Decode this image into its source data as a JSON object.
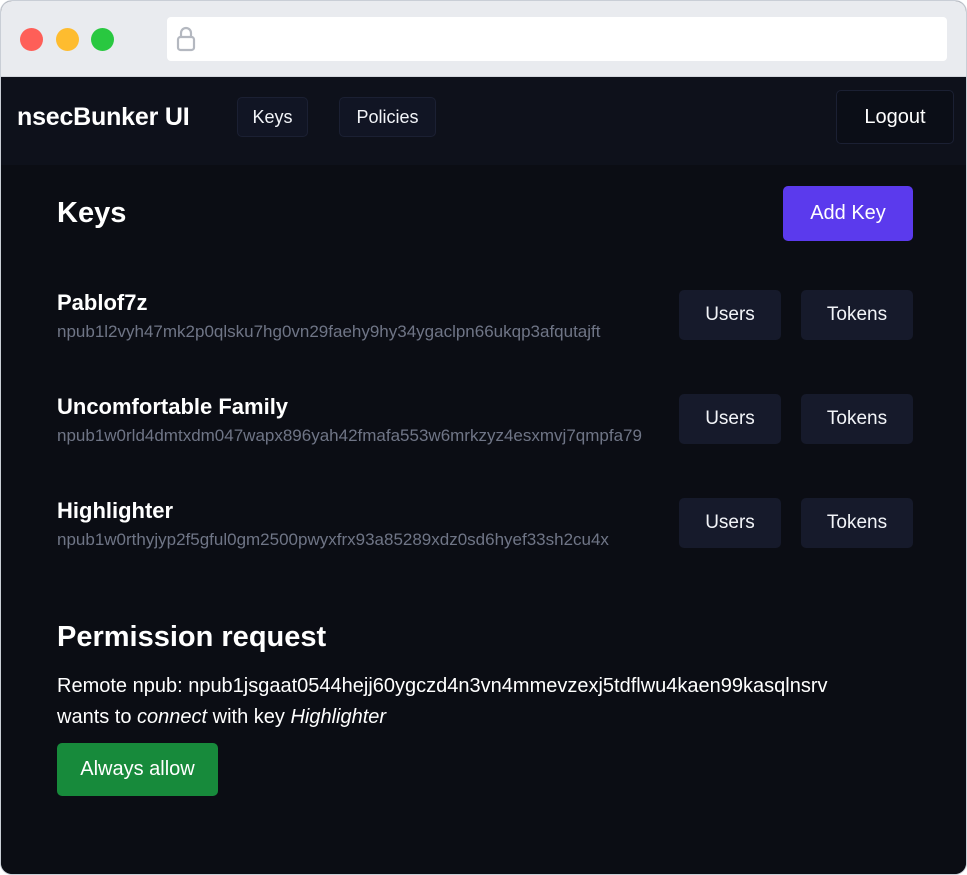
{
  "browser": {
    "url": "",
    "lock_icon": "lock-icon"
  },
  "navbar": {
    "brand": "nsecBunker UI",
    "keys_label": "Keys",
    "policies_label": "Policies",
    "logout_label": "Logout"
  },
  "main": {
    "title": "Keys",
    "add_key_label": "Add Key",
    "keys": [
      {
        "name": "Pablof7z",
        "npub": "npub1l2vyh47mk2p0qlsku7hg0vn29faehy9hy34ygaclpn66ukqp3afqutajft",
        "users_label": "Users",
        "tokens_label": "Tokens"
      },
      {
        "name": "Uncomfortable Family",
        "npub": "npub1w0rld4dmtxdm047wapx896yah42fmafa553w6mrkzyz4esxmvj7qmpfa79",
        "users_label": "Users",
        "tokens_label": "Tokens"
      },
      {
        "name": "Highlighter",
        "npub": "npub1w0rthyjyp2f5gful0gm2500pwyxfrx93a85289xdz0sd6hyef33sh2cu4x",
        "users_label": "Users",
        "tokens_label": "Tokens"
      }
    ]
  },
  "permission": {
    "title": "Permission request",
    "line1": "Remote npub: npub1jsgaat0544hejj60ygczd4n3vn4mmevzexj5tdflwu4kaen99kasqlnsrv",
    "wants_to": "wants to ",
    "action": "connect",
    "with_key": " with key ",
    "key_name": "Highlighter",
    "always_allow_label": "Always allow"
  },
  "colors": {
    "background": "#0b0d14",
    "accent": "#5b3aed",
    "success": "#178a3b"
  }
}
